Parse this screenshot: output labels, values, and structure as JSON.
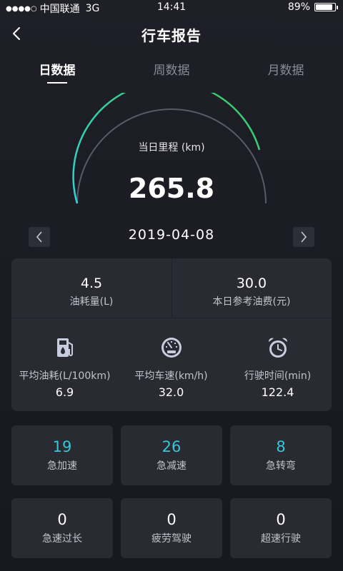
{
  "status_bar": {
    "signal_dots": "●●●●○",
    "carrier": "中国联通",
    "network": "3G",
    "time": "14:41",
    "battery": "89%"
  },
  "header": {
    "title": "行车报告"
  },
  "tabs": [
    {
      "label": "日数据",
      "active": true
    },
    {
      "label": "周数据",
      "active": false
    },
    {
      "label": "月数据",
      "active": false
    }
  ],
  "gauge": {
    "label": "当日里程 (km)",
    "value": "265.8",
    "gradient_start": "#2fd4d8",
    "gradient_end": "#3cc95a",
    "track_color": "#5a5a64"
  },
  "date": {
    "value": "2019-04-08"
  },
  "summary": {
    "fuel": {
      "value": "4.5",
      "label": "油耗量(L)"
    },
    "cost": {
      "value": "30.0",
      "label": "本日参考油费(元)"
    }
  },
  "stats": [
    {
      "icon": "fuel-pump-icon",
      "label": "平均油耗(L/100km)",
      "value": "6.9"
    },
    {
      "icon": "speedometer-icon",
      "label": "平均车速(km/h)",
      "value": "32.0"
    },
    {
      "icon": "alarm-clock-icon",
      "label": "行驶时间(min)",
      "value": "122.4"
    }
  ],
  "events_row1": [
    {
      "value": "19",
      "label": "急加速"
    },
    {
      "value": "26",
      "label": "急减速"
    },
    {
      "value": "8",
      "label": "急转弯"
    }
  ],
  "events_row2": [
    {
      "value": "0",
      "label": "急速过长"
    },
    {
      "value": "0",
      "label": "疲劳驾驶"
    },
    {
      "value": "0",
      "label": "超速行驶"
    }
  ],
  "colors": {
    "accent": "#36c6d6",
    "panel": "#2a2a33",
    "background": "#1e1e26"
  }
}
